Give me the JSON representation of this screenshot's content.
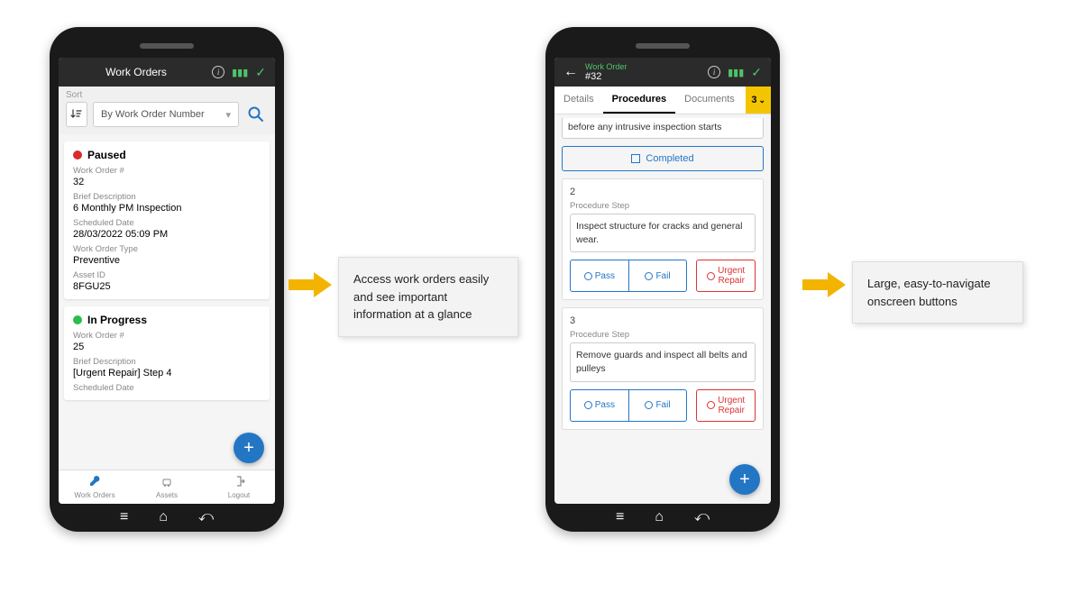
{
  "phone1": {
    "header": {
      "title": "Work Orders"
    },
    "sort": {
      "label": "Sort",
      "selected": "By Work Order Number"
    },
    "cards": [
      {
        "status": "Paused",
        "wo_label": "Work Order #",
        "wo_value": "32",
        "desc_label": "Brief Description",
        "desc_value": "6 Monthly PM Inspection",
        "sched_label": "Scheduled Date",
        "sched_value": "28/03/2022 05:09 PM",
        "type_label": "Work Order Type",
        "type_value": "Preventive",
        "asset_label": "Asset ID",
        "asset_value": "8FGU25"
      },
      {
        "status": "In Progress",
        "wo_label": "Work Order #",
        "wo_value": "25",
        "desc_label": "Brief Description",
        "desc_value": "[Urgent Repair] Step 4",
        "sched_label": "Scheduled Date"
      }
    ],
    "nav": {
      "work_orders": "Work Orders",
      "assets": "Assets",
      "logout": "Logout"
    }
  },
  "phone2": {
    "header": {
      "sub": "Work Order",
      "title": "#32"
    },
    "tabs": {
      "details": "Details",
      "procedures": "Procedures",
      "documents": "Documents",
      "badge": "3"
    },
    "partial_text": "before any intrusive inspection starts",
    "completed": "Completed",
    "steps": [
      {
        "num": "2",
        "label": "Procedure Step",
        "text": "Inspect structure for cracks and general wear.",
        "pass": "Pass",
        "fail": "Fail",
        "urgent": "Urgent Repair"
      },
      {
        "num": "3",
        "label": "Procedure Step",
        "text": "Remove guards and inspect all belts and pulleys",
        "pass": "Pass",
        "fail": "Fail",
        "urgent": "Urgent Repair"
      }
    ]
  },
  "callouts": {
    "c1": "Access work orders easily and see important information at a glance",
    "c2": "Large, easy-to-navigate onscreen buttons"
  }
}
